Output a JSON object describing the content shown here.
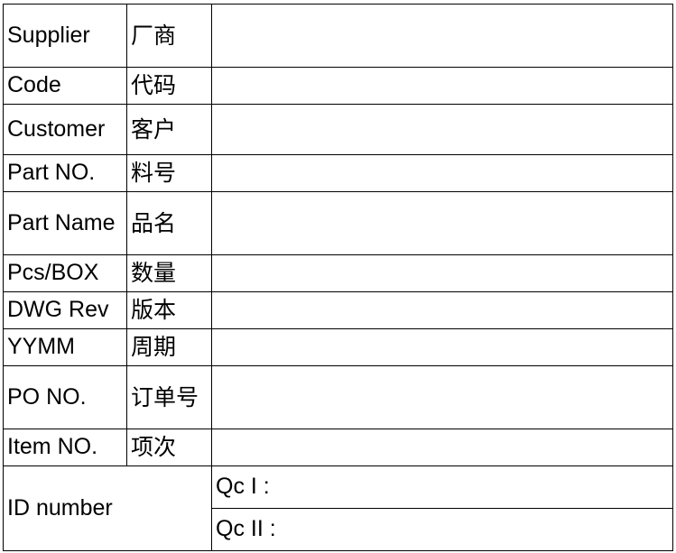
{
  "rows": [
    {
      "en": "Supplier",
      "cn": "厂商"
    },
    {
      "en": "Code",
      "cn": "代码"
    },
    {
      "en": "Customer",
      "cn": "客户"
    },
    {
      "en": "Part NO.",
      "cn": "料号"
    },
    {
      "en": "Part Name",
      "cn": "品名"
    },
    {
      "en": "Pcs/BOX",
      "cn": "数量"
    },
    {
      "en": "DWG Rev",
      "cn": "版本"
    },
    {
      "en": "YYMM",
      "cn": "周期"
    },
    {
      "en": "PO NO.",
      "cn": "订单号"
    },
    {
      "en": "Item NO.",
      "cn": "项次"
    }
  ],
  "id_section": {
    "label": "ID number",
    "qc1": "Qc I :",
    "qc2": "Qc II :"
  }
}
